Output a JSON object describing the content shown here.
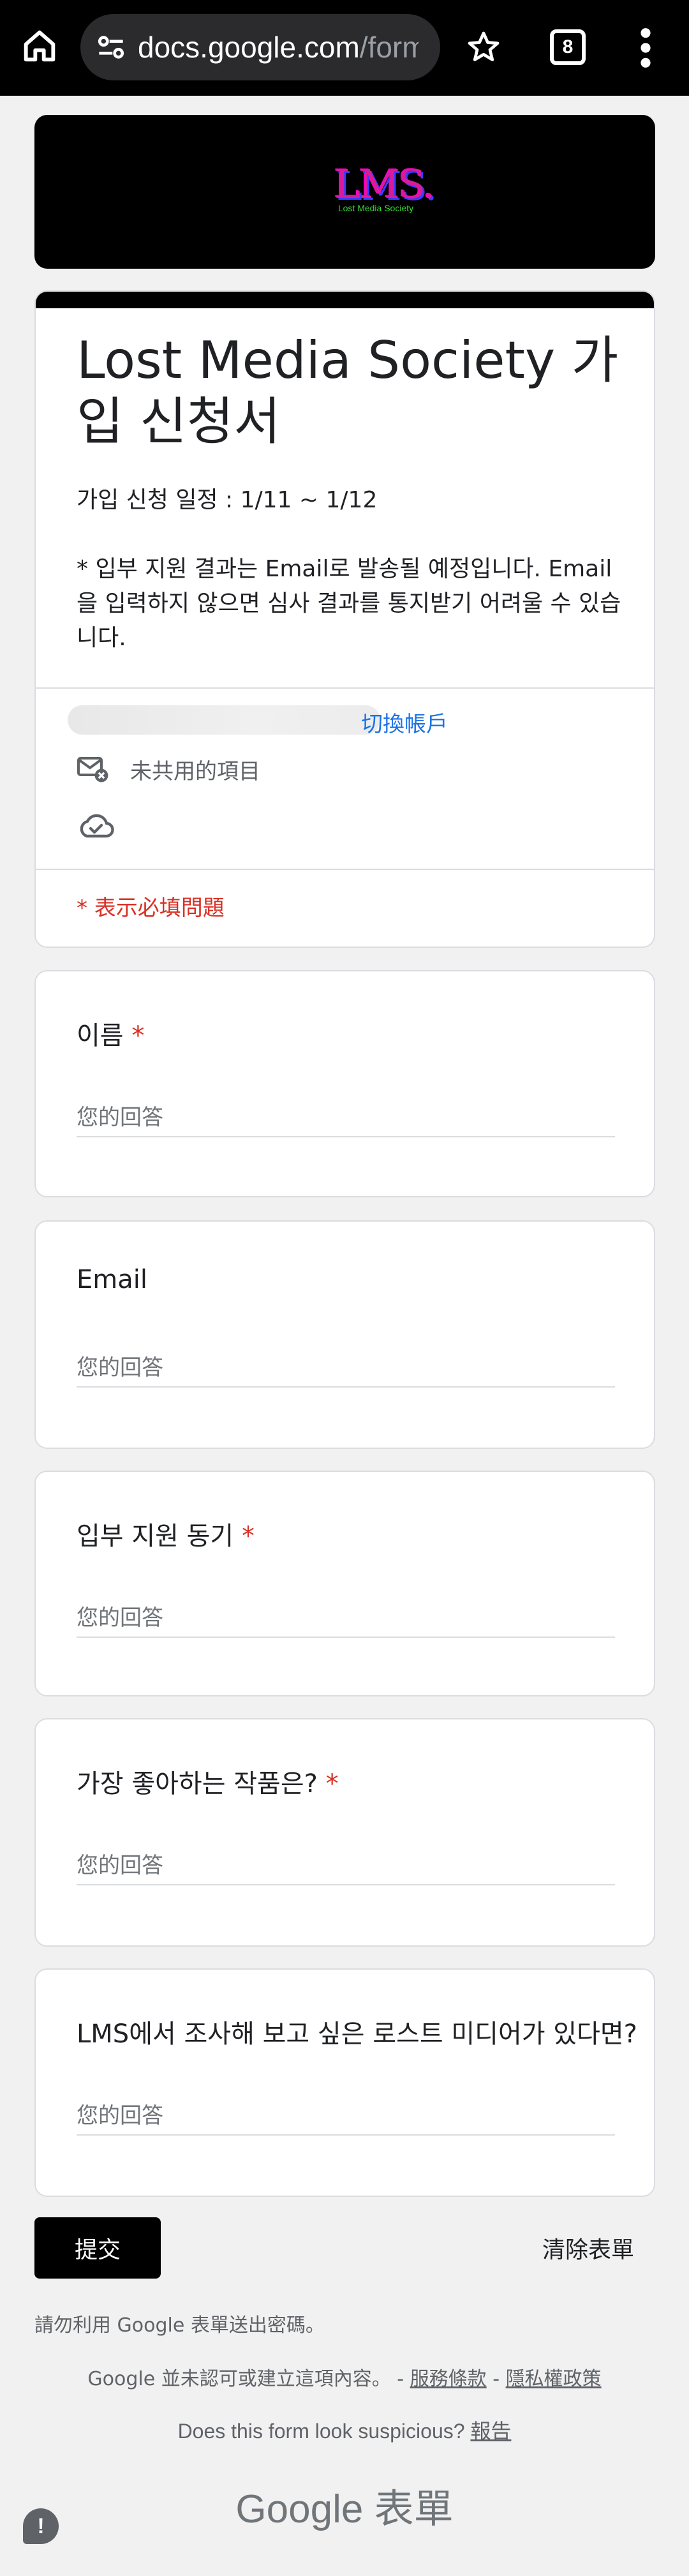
{
  "browser": {
    "url_main": "docs.google.com",
    "url_rest": "/forms/",
    "tab_count": "8"
  },
  "header": {
    "logo_text": "LMS.",
    "logo_subtext": "Lost Media Society"
  },
  "form": {
    "title": "Lost Media Society 가입 신청서",
    "description": "가입 신청 일정 : 1/11 ~ 1/12\n\n* 입부 지원 결과는 Email로 발송될 예정입니다. Email을 입력하지 않으면 심사 결과를 통지받기 어려울 수 있습니다.",
    "switch_account": "切換帳戶",
    "not_shared": "未共用的項目",
    "required_note": "* 表示必填問題"
  },
  "questions": [
    {
      "label": "이름",
      "required": "*",
      "placeholder": "您的回答"
    },
    {
      "label": "Email",
      "required": "",
      "placeholder": "您的回答"
    },
    {
      "label": "입부 지원 동기",
      "required": "*",
      "placeholder": "您的回答"
    },
    {
      "label": "가장 좋아하는 작품은?",
      "required": "*",
      "placeholder": "您的回答"
    },
    {
      "label": "LMS에서 조사해 보고 싶은 로스트 미디어가 있다면?",
      "required": "",
      "placeholder": "您的回答"
    }
  ],
  "footer": {
    "submit": "提交",
    "clear": "清除表單",
    "warning": "請勿利用 Google 表單送出密碼。",
    "legal_prefix": "Google 並未認可或建立這項內容。 - ",
    "terms": "服務條款",
    "separator": " - ",
    "privacy": "隱私權政策",
    "suspicious_prefix": "Does this form look suspicious? ",
    "report": "報告",
    "brand": "Google 表單",
    "report_icon": "!"
  }
}
